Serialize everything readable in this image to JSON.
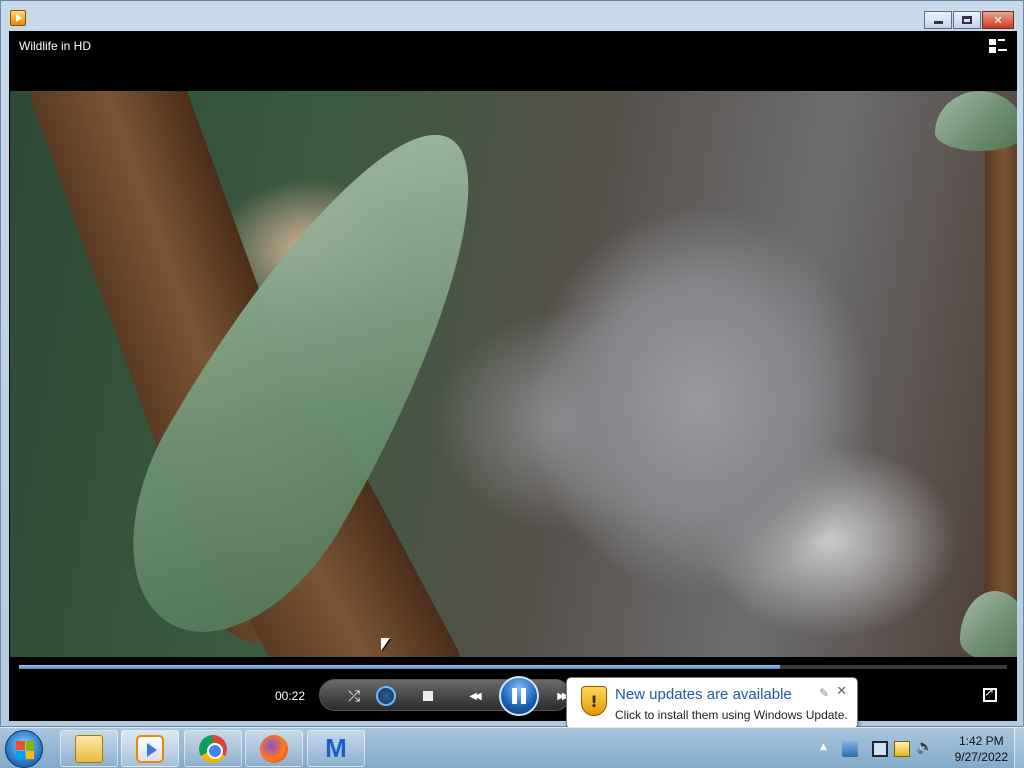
{
  "window": {
    "title": "",
    "controls": {
      "minimize": "",
      "maximize": "",
      "close": "✕"
    }
  },
  "player": {
    "video_title": "Wildlife in HD",
    "time_elapsed": "00:22",
    "progress_fraction": 0.77,
    "controls": {
      "shuffle_glyph": "⤮",
      "prev_glyph": "◀◀",
      "next_glyph": "▶▶"
    }
  },
  "notification": {
    "title": "New updates are available",
    "text": "Click to install them using Windows Update.",
    "shield_glyph": "!",
    "options_glyph": "✎",
    "close_glyph": "✕"
  },
  "taskbar": {
    "pinned": [
      {
        "name": "windows-explorer",
        "icon": "folder-icon"
      },
      {
        "name": "windows-media-player",
        "icon": "media-player-icon",
        "active": true
      },
      {
        "name": "google-chrome",
        "icon": "chrome-icon"
      },
      {
        "name": "firefox",
        "icon": "firefox-icon"
      },
      {
        "name": "malwarebytes",
        "icon": "malwarebytes-icon",
        "glyph": "M"
      }
    ],
    "tray": {
      "arrow_glyph": "▲",
      "volume_glyph": "🔊",
      "time": "1:42 PM",
      "date": "9/27/2022"
    }
  },
  "colors": {
    "accent": "#1f5aa6",
    "seek_fill": "#4f86c6",
    "taskbar": "#85a9c9"
  }
}
